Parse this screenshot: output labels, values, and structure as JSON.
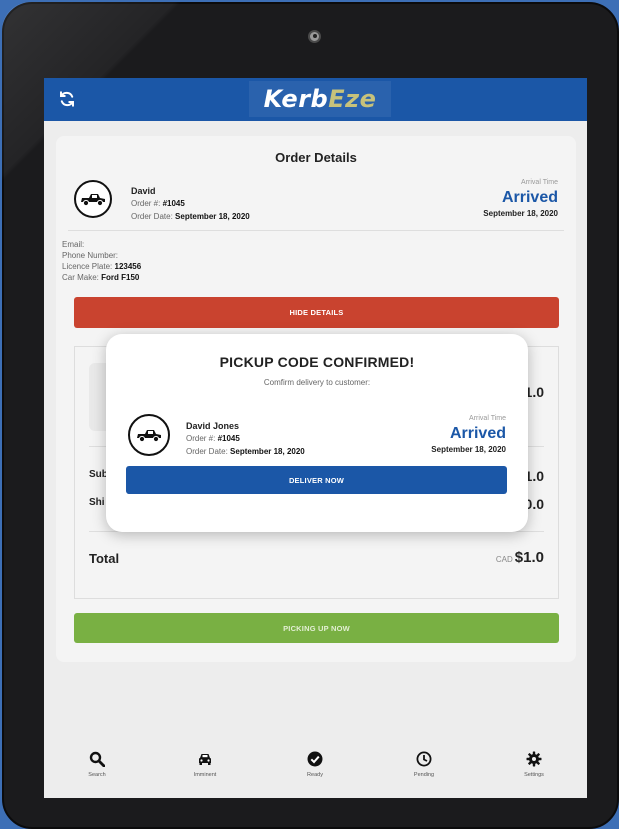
{
  "header": {
    "logo_part1": "Kerb",
    "logo_part2": "Eze"
  },
  "order": {
    "title": "Order Details",
    "customer_name": "David",
    "order_label": "Order #:",
    "order_number": "#1045",
    "date_label": "Order Date:",
    "order_date": "September 18, 2020",
    "arrival_label": "Arrival Time",
    "arrival_status": "Arrived",
    "arrival_date": "September 18, 2020",
    "email_label": "Email:",
    "phone_label": "Phone Number:",
    "plate_label": "Licence Plate:",
    "plate_value": "123456",
    "make_label": "Car Make:",
    "make_value": "Ford F150",
    "hide_details_label": "HIDE DETAILS",
    "picking_up_label": "PICKING UP NOW"
  },
  "items_summary": {
    "item_price": "$1.0",
    "subtotal_label": "Sub",
    "subtotal_value": "$1.0",
    "shipping_label": "Shi",
    "shipping_value": "$0.0",
    "total_label": "Total",
    "total_currency": "CAD",
    "total_value": "$1.0"
  },
  "modal": {
    "title": "PICKUP CODE CONFIRMED!",
    "subtitle": "Comfirm delivery to customer:",
    "customer_name": "David Jones",
    "order_label": "Order #:",
    "order_number": "#1045",
    "date_label": "Order Date:",
    "order_date": "September 18, 2020",
    "arrival_label": "Arrival Time",
    "arrival_status": "Arrived",
    "arrival_date": "September 18, 2020",
    "deliver_label": "DELIVER NOW"
  },
  "nav": {
    "items": [
      {
        "label": "Search",
        "icon": "search-icon"
      },
      {
        "label": "Imminent",
        "icon": "car-icon"
      },
      {
        "label": "Ready",
        "icon": "check-circle-icon"
      },
      {
        "label": "Pending",
        "icon": "clock-icon"
      },
      {
        "label": "Settings",
        "icon": "gear-icon"
      }
    ]
  },
  "colors": {
    "brand_blue": "#1b57a7",
    "hide_red": "#c9432f",
    "picking_green": "#79b043",
    "logo_accent": "#c7c27b"
  }
}
